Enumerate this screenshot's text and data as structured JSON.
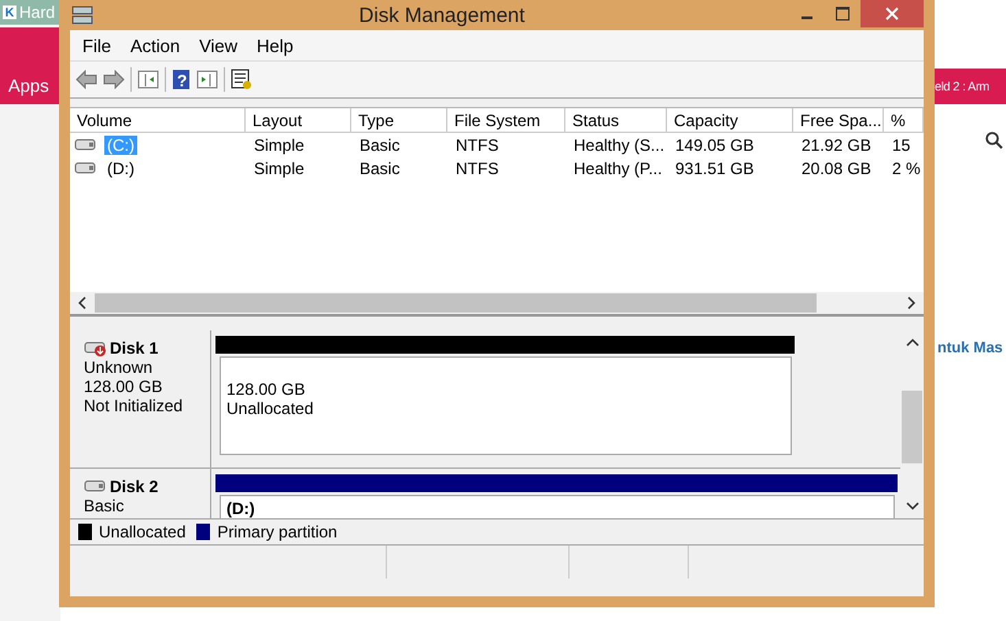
{
  "background": {
    "tab_logo": "K",
    "tab_title": "Hard",
    "apps_label": "Apps",
    "banner_text": "eld 2 : Arm",
    "link_text": "ntuk Mas"
  },
  "window": {
    "title": "Disk Management",
    "menu": [
      "File",
      "Action",
      "View",
      "Help"
    ],
    "help_glyph": "?",
    "columns": [
      "Volume",
      "Layout",
      "Type",
      "File System",
      "Status",
      "Capacity",
      "Free Spa...",
      "%"
    ],
    "rows": [
      {
        "selected": true,
        "cells": [
          "(C:)",
          "Simple",
          "Basic",
          "NTFS",
          "Healthy (S...",
          "149.05 GB",
          "21.92 GB",
          "15"
        ]
      },
      {
        "selected": false,
        "cells": [
          "(D:)",
          "Simple",
          "Basic",
          "NTFS",
          "Healthy (P...",
          "931.51 GB",
          "20.08 GB",
          "2 %"
        ]
      }
    ],
    "disks": [
      {
        "name": "Disk 1",
        "kind": "unknown",
        "details": [
          "Unknown",
          "128.00 GB",
          "Not Initialized"
        ],
        "partitions": [
          {
            "color": "#000000",
            "lines": [
              "128.00 GB",
              "Unallocated"
            ]
          }
        ]
      },
      {
        "name": "Disk 2",
        "kind": "basic",
        "details": [
          "Basic"
        ],
        "partitions": [
          {
            "color": "#00007f",
            "lines": [
              "(D:)"
            ]
          }
        ]
      }
    ],
    "legend": [
      {
        "label": "Unallocated",
        "color": "#000000"
      },
      {
        "label": "Primary partition",
        "color": "#00007f"
      }
    ]
  }
}
